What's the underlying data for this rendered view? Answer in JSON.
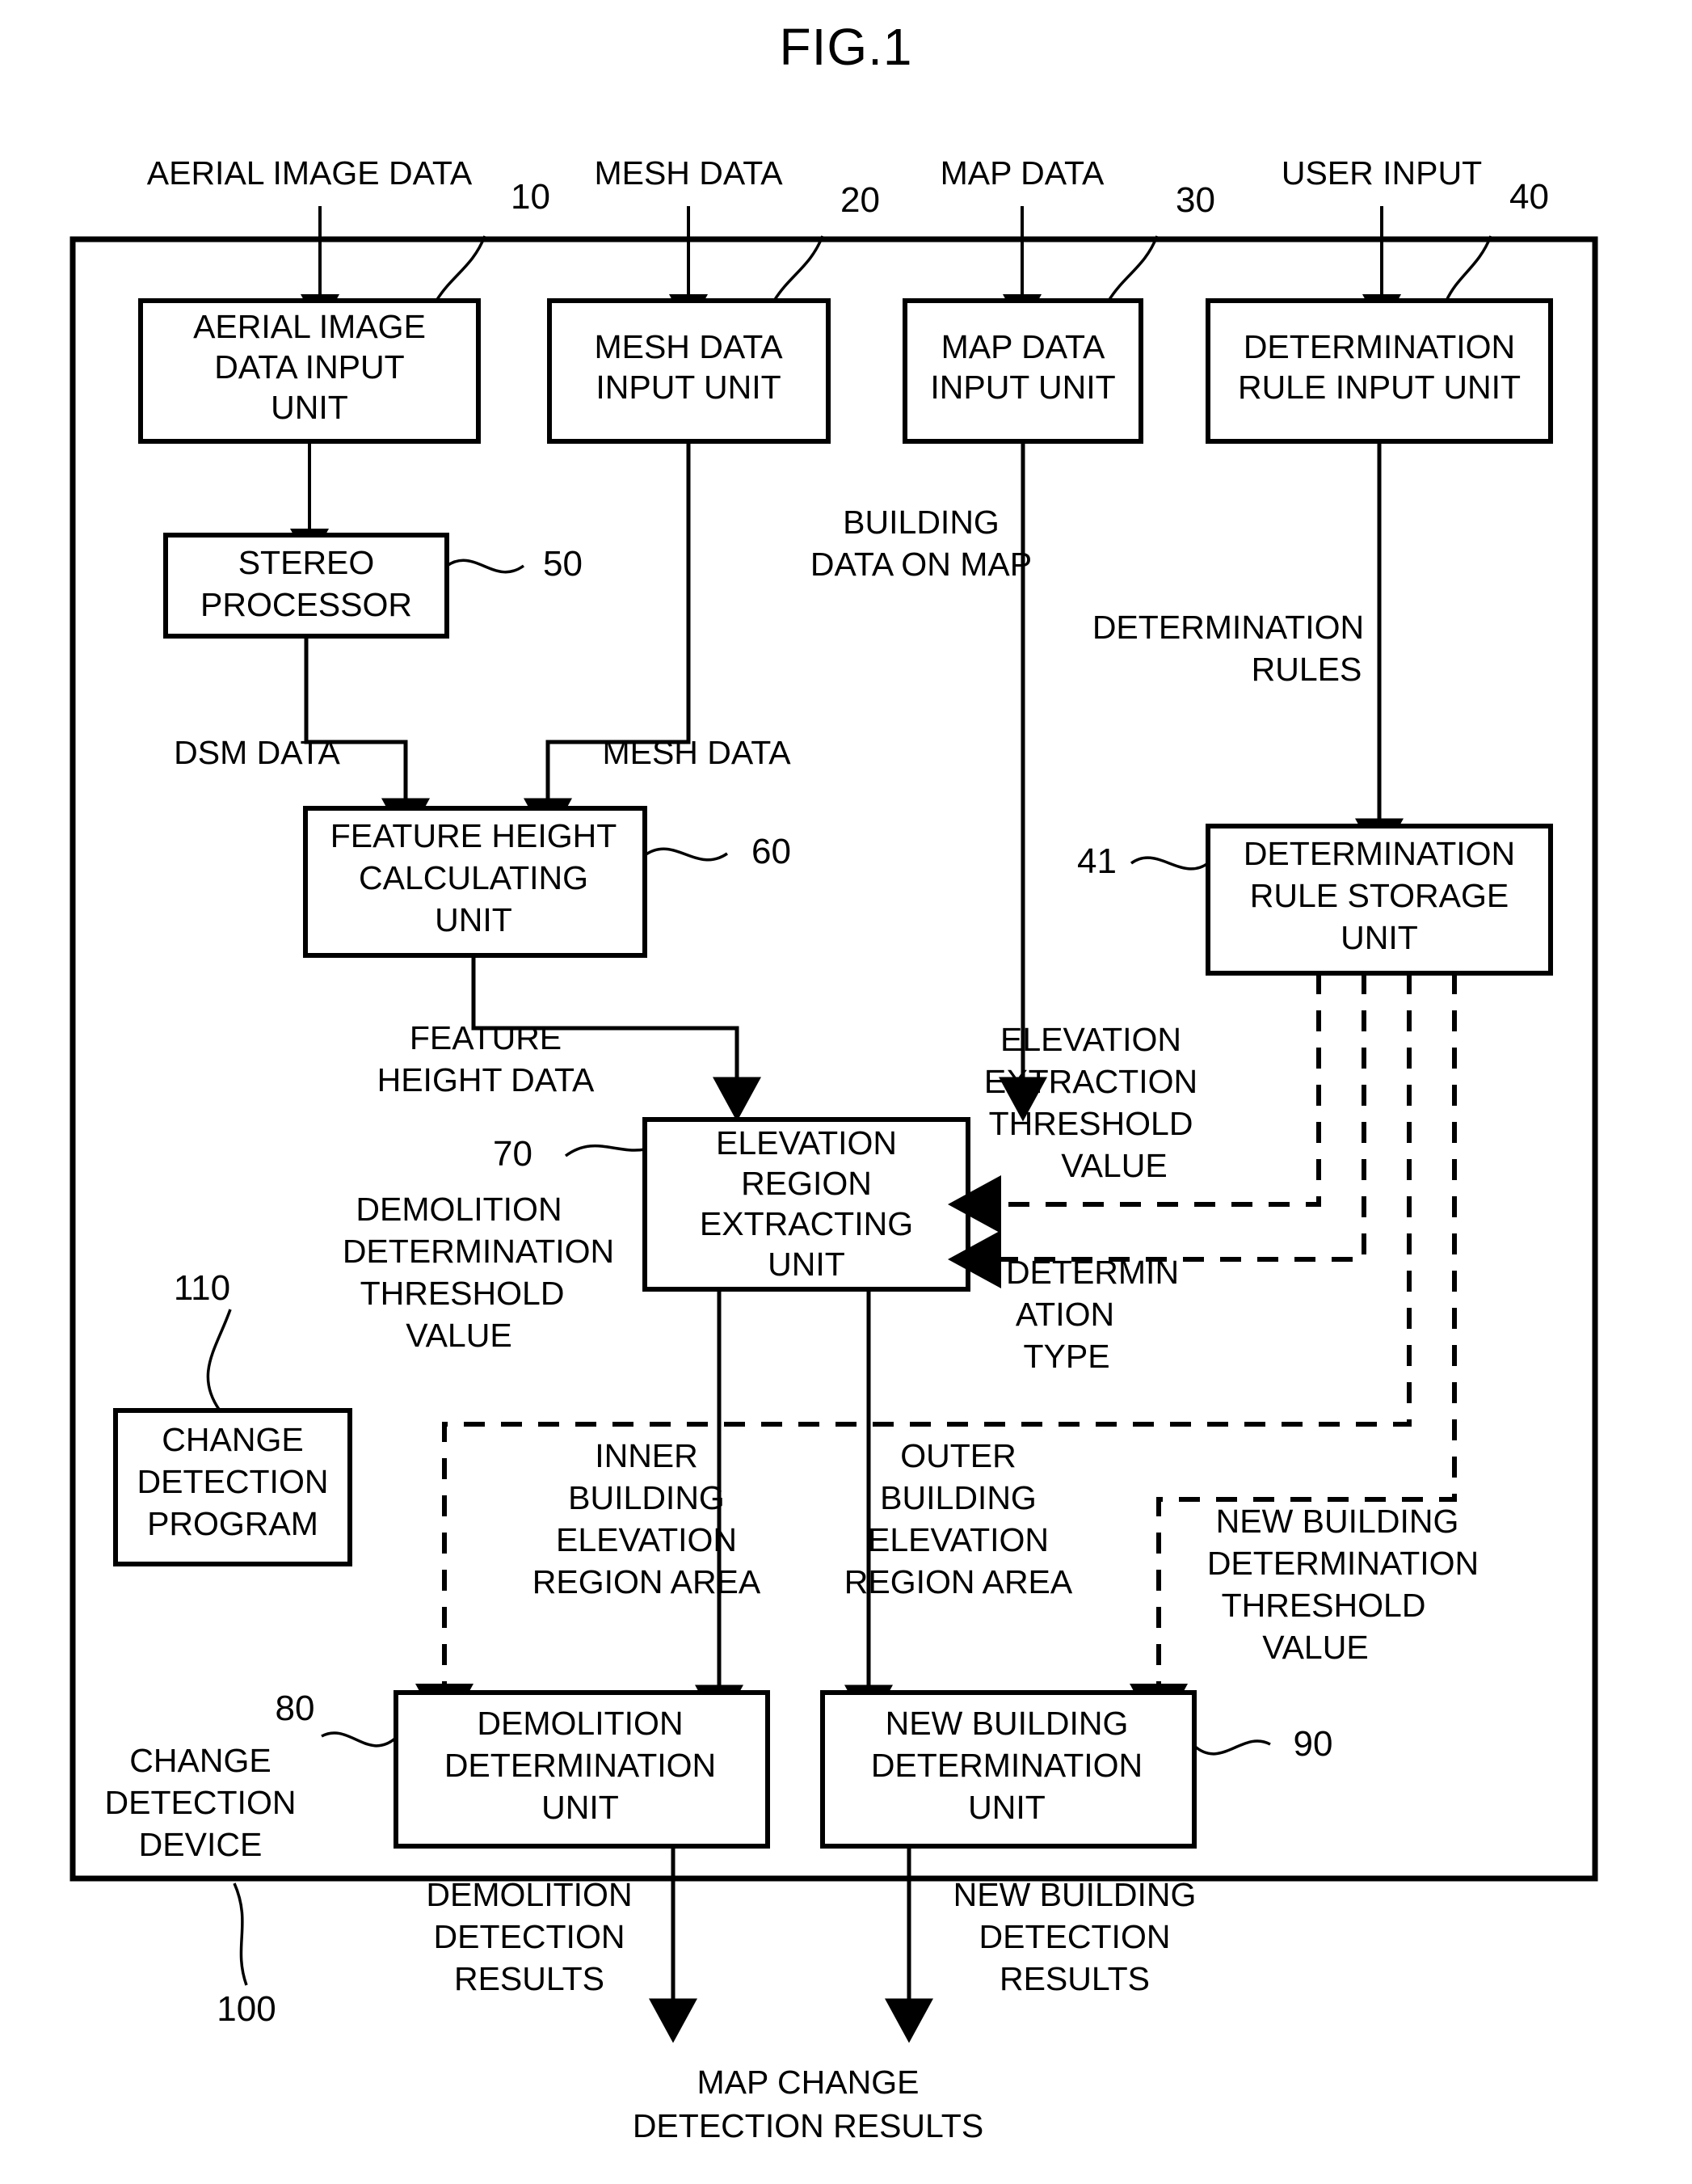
{
  "figure": {
    "title": "FIG.1"
  },
  "inputs": [
    {
      "label": "AERIAL IMAGE DATA"
    },
    {
      "label": "MESH DATA"
    },
    {
      "label": "MAP DATA"
    },
    {
      "label": "USER INPUT"
    }
  ],
  "boxes": {
    "aerial_image_data_input_unit": {
      "lines": [
        "AERIAL IMAGE",
        "DATA INPUT",
        "UNIT"
      ],
      "ref": "10"
    },
    "mesh_data_input_unit": {
      "lines": [
        "MESH DATA",
        "INPUT UNIT"
      ],
      "ref": "20"
    },
    "map_data_input_unit": {
      "lines": [
        "MAP DATA",
        "INPUT UNIT"
      ],
      "ref": "30"
    },
    "determination_rule_input_unit": {
      "lines": [
        "DETERMINATION",
        "RULE INPUT UNIT"
      ],
      "ref": "40"
    },
    "stereo_processor": {
      "lines": [
        "STEREO",
        "PROCESSOR"
      ],
      "ref": "50"
    },
    "feature_height_calculating_unit": {
      "lines": [
        "FEATURE HEIGHT",
        "CALCULATING",
        "UNIT"
      ],
      "ref": "60"
    },
    "determination_rule_storage_unit": {
      "lines": [
        "DETERMINATION",
        "RULE STORAGE",
        "UNIT"
      ],
      "ref": "41"
    },
    "elevation_region_extracting_unit": {
      "lines": [
        "ELEVATION",
        "REGION",
        "EXTRACTING",
        "UNIT"
      ],
      "ref": "70"
    },
    "change_detection_program": {
      "lines": [
        "CHANGE",
        "DETECTION",
        "PROGRAM"
      ],
      "ref": "110"
    },
    "demolition_determination_unit": {
      "lines": [
        "DEMOLITION",
        "DETERMINATION",
        "UNIT"
      ],
      "ref": "80"
    },
    "new_building_determination_unit": {
      "lines": [
        "NEW BUILDING",
        "DETERMINATION",
        "UNIT"
      ],
      "ref": "90"
    }
  },
  "device": {
    "lines": [
      "CHANGE",
      "DETECTION",
      "DEVICE"
    ],
    "ref": "100"
  },
  "flow_labels": {
    "building_data_on_map": [
      "BUILDING",
      "DATA ON MAP"
    ],
    "determination_rules": [
      "DETERMINATION",
      "RULES"
    ],
    "dsm_data": [
      "DSM DATA"
    ],
    "mesh_data": [
      "MESH DATA"
    ],
    "feature_height_data": [
      "FEATURE",
      "HEIGHT DATA"
    ],
    "elevation_extraction_threshold_value": [
      "ELEVATION",
      "EXTRACTION",
      "THRESHOLD",
      "VALUE"
    ],
    "determination_type": [
      "DETERMIN",
      "ATION",
      "TYPE"
    ],
    "demolition_determination_threshold_value": [
      "DEMOLITION",
      "DETERMINATION",
      "THRESHOLD",
      "VALUE"
    ],
    "inner_building_elevation_region_area": [
      "INNER",
      "BUILDING",
      "ELEVATION",
      "REGION AREA"
    ],
    "outer_building_elevation_region_area": [
      "OUTER",
      "BUILDING",
      "ELEVATION",
      "REGION AREA"
    ],
    "new_building_determination_threshold_value": [
      "NEW BUILDING",
      "DETERMINATION",
      "THRESHOLD",
      "VALUE"
    ],
    "demolition_detection_results": [
      "DEMOLITION",
      "DETECTION",
      "RESULTS"
    ],
    "new_building_detection_results": [
      "NEW BUILDING",
      "DETECTION",
      "RESULTS"
    ],
    "map_change_detection_results": [
      "MAP CHANGE",
      "DETECTION RESULTS"
    ]
  },
  "colors": {
    "ink": "#000000",
    "paper": "#ffffff"
  }
}
